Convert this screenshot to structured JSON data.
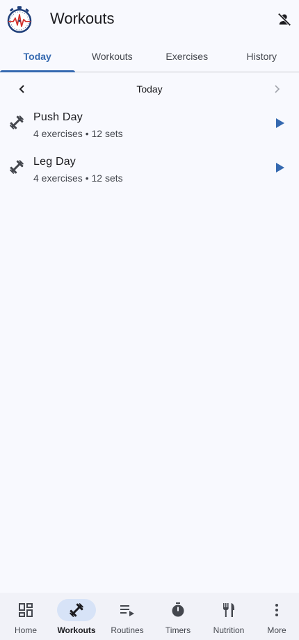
{
  "app_bar": {
    "title": "Workouts",
    "logo_icon": "stopwatch-heartbeat-logo",
    "account_icon": "person-off-icon"
  },
  "tabs": [
    {
      "label": "Today",
      "active": true
    },
    {
      "label": "Workouts",
      "active": false
    },
    {
      "label": "Exercises",
      "active": false
    },
    {
      "label": "History",
      "active": false
    }
  ],
  "date_nav": {
    "label": "Today",
    "prev_icon": "chevron-left-icon",
    "next_icon": "chevron-right-icon"
  },
  "workouts": [
    {
      "name": "Push Day",
      "subtitle": "4 exercises • 12 sets",
      "icon": "dumbbell-icon",
      "action_icon": "play-icon"
    },
    {
      "name": "Leg Day",
      "subtitle": "4 exercises • 12 sets",
      "icon": "dumbbell-icon",
      "action_icon": "play-icon"
    }
  ],
  "bottom_nav": [
    {
      "label": "Home",
      "icon": "dashboard-icon",
      "active": false
    },
    {
      "label": "Workouts",
      "icon": "dumbbell-icon",
      "active": true
    },
    {
      "label": "Routines",
      "icon": "playlist-play-icon",
      "active": false
    },
    {
      "label": "Timers",
      "icon": "timer-icon",
      "active": false
    },
    {
      "label": "Nutrition",
      "icon": "fork-knife-icon",
      "active": false
    },
    {
      "label": "More",
      "icon": "more-vertical-icon",
      "active": false
    }
  ],
  "colors": {
    "accent": "#3569b0",
    "background": "#f8f9fe",
    "nav_active_pill": "#d7e3f7",
    "play": "#3569b0"
  }
}
